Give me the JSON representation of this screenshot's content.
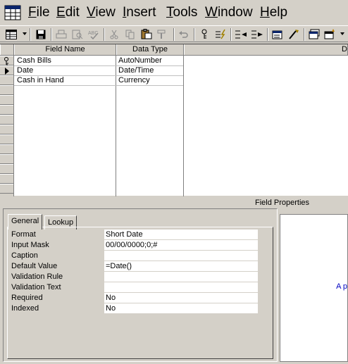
{
  "menu": [
    "File",
    "Edit",
    "View",
    "Insert",
    "Tools",
    "Window",
    "Help"
  ],
  "toolbar": {
    "view_icon": "datasheet-view-icon",
    "save_icon": "save-icon"
  },
  "grid": {
    "headers": [
      "Field Name",
      "Data Type",
      "D"
    ],
    "rows": [
      {
        "name": "Cash Bills",
        "type": "AutoNumber",
        "key": true
      },
      {
        "name": "Date",
        "type": "Date/Time",
        "current": true
      },
      {
        "name": "Cash in Hand",
        "type": "Currency"
      }
    ]
  },
  "field_properties": {
    "title": "Field Properties",
    "tabs": [
      "General",
      "Lookup"
    ],
    "active_tab": "General",
    "props": [
      {
        "label": "Format",
        "value": "Short Date"
      },
      {
        "label": "Input Mask",
        "value": "00/00/0000;0;#"
      },
      {
        "label": "Caption",
        "value": ""
      },
      {
        "label": "Default Value",
        "value": "=Date()"
      },
      {
        "label": "Validation Rule",
        "value": ""
      },
      {
        "label": "Validation Text",
        "value": ""
      },
      {
        "label": "Required",
        "value": "No"
      },
      {
        "label": "Indexed",
        "value": "No"
      }
    ],
    "help_text": "A p"
  },
  "colors": {
    "face": "#d4d0c8",
    "help_link": "#0000c0"
  }
}
